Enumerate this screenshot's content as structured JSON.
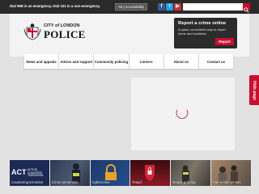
{
  "topbar": {
    "emergency": "Dial 999 in an emergency. Dial 101 in a non-emergency",
    "accessibility_label": "Aä | Accessibility",
    "social": [
      {
        "name": "facebook-icon",
        "glyph": "f"
      },
      {
        "name": "twitter-icon",
        "glyph": "t"
      },
      {
        "name": "youtube-icon",
        "glyph": "▶"
      }
    ],
    "search": {
      "placeholder": "",
      "value": ""
    }
  },
  "header": {
    "logo_small": "CITY of LONDON",
    "logo_big": "POLICE",
    "report": {
      "title": "Report a crime online",
      "text": "A quick, convenient way to report crime and incidents.",
      "button": "Report"
    }
  },
  "nav": {
    "items": [
      "News and appeals",
      "Advice and support",
      "Community policing",
      "Careers",
      "About us",
      "Contact us"
    ]
  },
  "side_tab": {
    "label": "Hide page"
  },
  "tiles": [
    {
      "label": "Countering terrorism",
      "logo": "ACT",
      "logo_sub": "ACTION COUNTERS TERRORISM"
    },
    {
      "label": "Crime prevention"
    },
    {
      "label": "Cybercrime"
    },
    {
      "label": "Fraud"
    },
    {
      "label": "Roads policing"
    },
    {
      "label": "Vulnerable people"
    }
  ],
  "colors": {
    "brand_red": "#c8102e",
    "topbar": "#2a2a2a",
    "report_box": "#2b2b2b"
  }
}
